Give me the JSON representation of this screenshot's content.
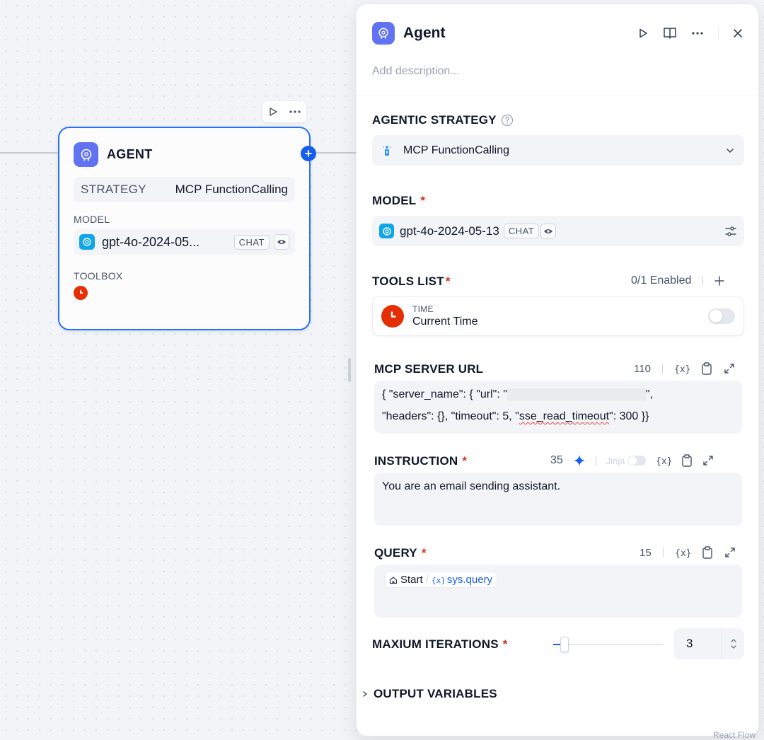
{
  "canvas": {
    "node": {
      "title": "AGENT",
      "strategy_label": "STRATEGY",
      "strategy_value": "MCP FunctionCalling",
      "model_label": "MODEL",
      "model_name": "gpt-4o-2024-05...",
      "model_mode": "CHAT",
      "toolbox_label": "TOOLBOX"
    },
    "watermark": "React Flow"
  },
  "panel": {
    "title": "Agent",
    "description_placeholder": "Add description...",
    "strategy": {
      "label": "AGENTIC STRATEGY",
      "value": "MCP FunctionCalling"
    },
    "model": {
      "label": "MODEL",
      "name": "gpt-4o-2024-05-13",
      "mode": "CHAT"
    },
    "tools": {
      "label": "TOOLS LIST",
      "enabled_count": "0/1 Enabled",
      "items": [
        {
          "provider": "TIME",
          "name": "Current Time",
          "enabled": false
        }
      ]
    },
    "mcp_server_url": {
      "label": "MCP SERVER URL",
      "count": "110",
      "line1_prefix": "{ \"server_name\": { \"url\": \"",
      "line1_suffix": "\",",
      "line2_prefix": "\"headers\": {}, \"timeout\": 5, \"",
      "line2_underlined": "sse_read_timeout",
      "line2_suffix": "\": 300 }}"
    },
    "instruction": {
      "label": "INSTRUCTION",
      "count": "35",
      "jinja_label": "Jinja",
      "text": "You are an email sending assistant."
    },
    "query": {
      "label": "QUERY",
      "count": "15",
      "var_node": "Start",
      "var_name": "sys.query"
    },
    "max_iterations": {
      "label": "MAXIUM ITERATIONS",
      "value": "3",
      "slider_fraction": 0.1
    },
    "output_variables": {
      "label": "OUTPUT VARIABLES"
    }
  },
  "colors": {
    "accent": "#155eef",
    "agent_badge": "#6172f3",
    "required": "#d92d20",
    "time_tool": "#e62e05",
    "openai": "#0ea5e9"
  },
  "icons": [
    "agent-icon",
    "play-icon",
    "more-icon",
    "book-icon",
    "close-icon",
    "help-icon",
    "chevron-down-icon",
    "openai-icon",
    "eye-icon",
    "settings-sliders-icon",
    "plus-icon",
    "clock-icon",
    "variable-icon",
    "clipboard-icon",
    "expand-icon",
    "sparkle-icon",
    "home-icon",
    "chevron-right-icon"
  ]
}
